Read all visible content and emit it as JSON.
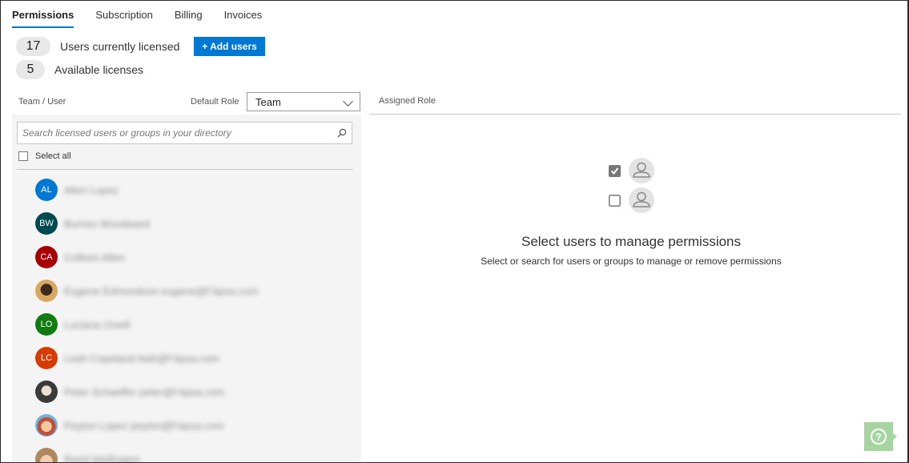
{
  "tabs": [
    {
      "label": "Permissions",
      "active": true
    },
    {
      "label": "Subscription",
      "active": false
    },
    {
      "label": "Billing",
      "active": false
    },
    {
      "label": "Invoices",
      "active": false
    }
  ],
  "licenses": {
    "used_count": "17",
    "used_label": "Users currently licensed",
    "available_count": "5",
    "available_label": "Available licenses",
    "add_button": "+ Add users"
  },
  "left_header": {
    "column_label": "Team / User",
    "default_role_label": "Default Role",
    "default_role_value": "Team"
  },
  "search": {
    "placeholder": "Search licensed users or groups in your directory"
  },
  "select_all_label": "Select all",
  "users": [
    {
      "initials": "AL",
      "name": "Allen Lopez",
      "color": "#0078d4"
    },
    {
      "initials": "BW",
      "name": "Burnes Woodward",
      "color": "#004b50"
    },
    {
      "initials": "CA",
      "name": "Colleen Allen",
      "color": "#a80000"
    },
    {
      "initials": "",
      "name": "Eugene Edmondson eugene@f-bpsa.com",
      "color": "#c08040"
    },
    {
      "initials": "LO",
      "name": "Luciana Oneill",
      "color": "#107c10"
    },
    {
      "initials": "LC",
      "name": "Leah Copeland leah@f-bpsa.com",
      "color": "#d83b01"
    },
    {
      "initials": "",
      "name": "Peter Schaeffer peter@f-bpsa.com",
      "color": "#5a5a5a"
    },
    {
      "initials": "",
      "name": "Peyton Lopez peyton@f-bpsa.com",
      "color": "#d9774b"
    },
    {
      "initials": "",
      "name": "Reed Wellington",
      "color": "#c9a27a"
    }
  ],
  "right_panel": {
    "header": "Assigned Role",
    "empty_title": "Select users to manage permissions",
    "empty_subtitle": "Select or search for users or groups to manage or remove permissions"
  },
  "help": {
    "label": "?"
  },
  "colors": {
    "accent": "#0078d4",
    "help": "#a5d6a0"
  }
}
